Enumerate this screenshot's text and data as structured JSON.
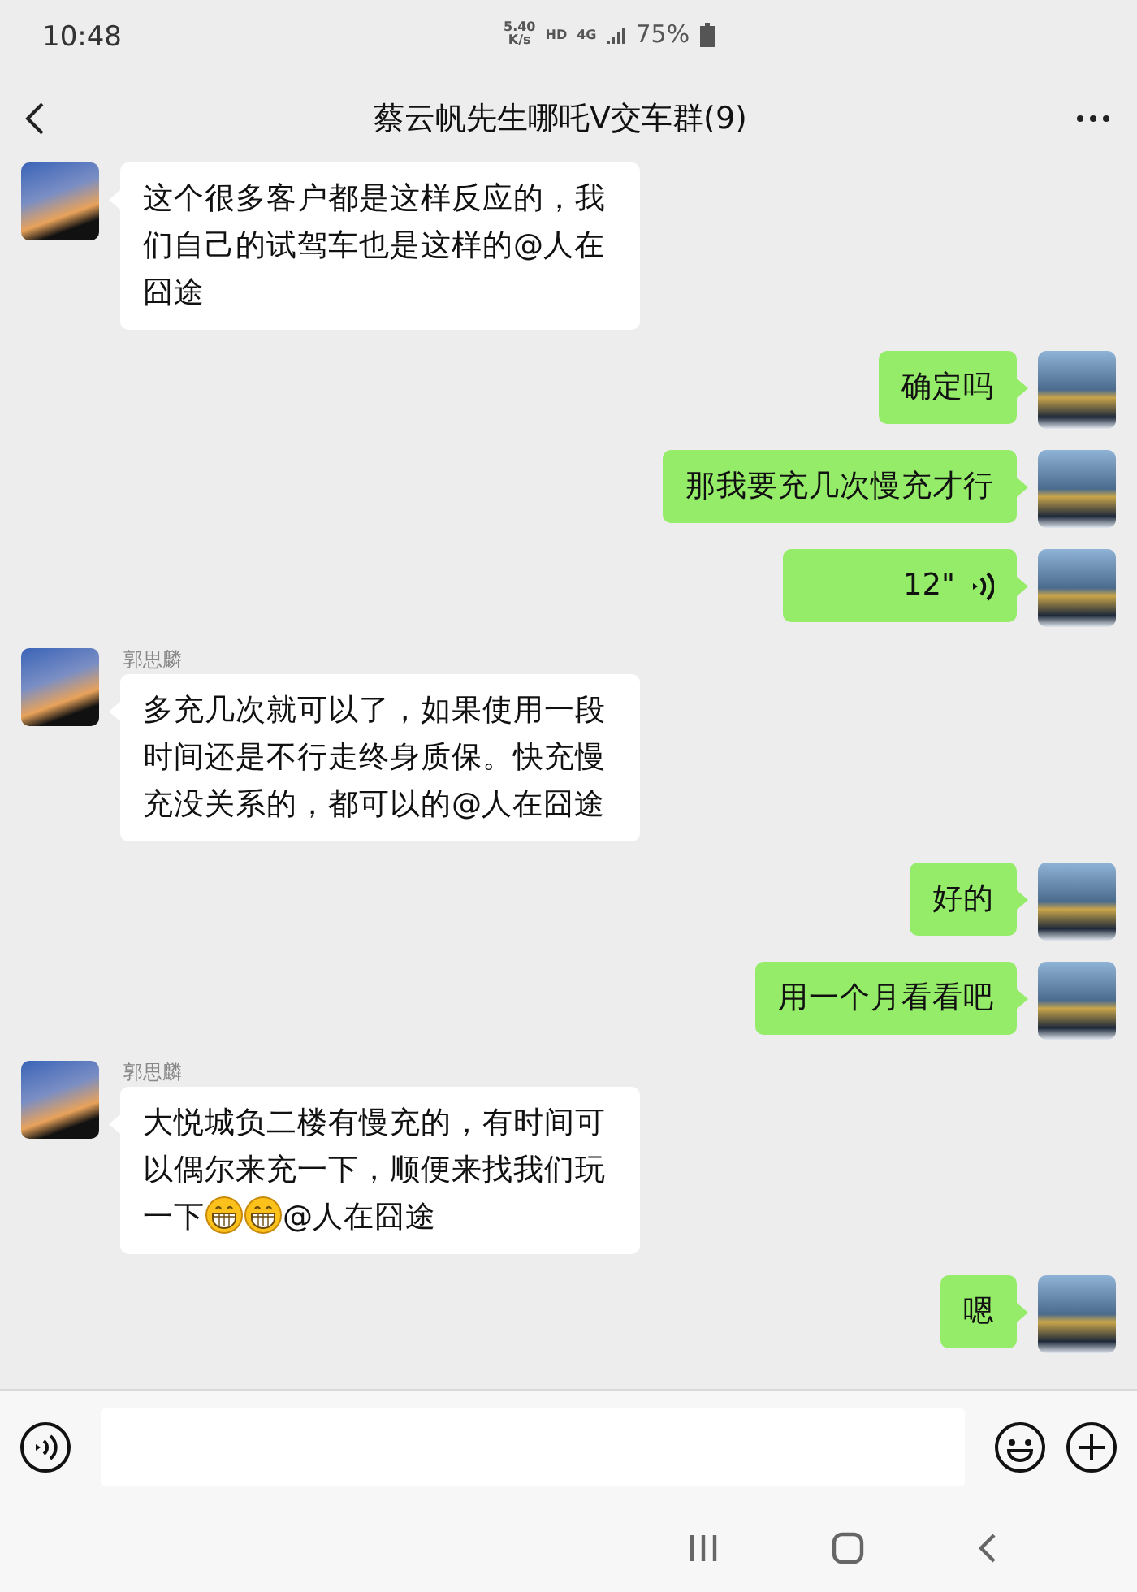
{
  "status_bar": {
    "time": "10:48",
    "speed": "5.40",
    "speed_unit": "K/s",
    "hd": "HD",
    "network": "4G",
    "battery": "75%"
  },
  "header": {
    "title": "蔡云帆先生哪吒V交车群(9)"
  },
  "messages": [
    {
      "kind": "text",
      "outgoing": false,
      "segments": [
        {
          "kind": "text",
          "text": "这个很多客户都是这样反应的，我们自己的试驾车也是这样的@人在囧途"
        }
      ]
    },
    {
      "kind": "text",
      "outgoing": true,
      "segments": [
        {
          "kind": "text",
          "text": "确定吗"
        }
      ]
    },
    {
      "kind": "text",
      "outgoing": true,
      "segments": [
        {
          "kind": "text",
          "text": "那我要充几次慢充才行"
        }
      ]
    },
    {
      "kind": "voice",
      "outgoing": true,
      "duration": "12\""
    },
    {
      "kind": "text",
      "outgoing": false,
      "sender": "郭思麟",
      "segments": [
        {
          "kind": "text",
          "text": "多充几次就可以了，如果使用一段时间还是不行走终身质保。快充慢充没关系的，都可以的@人在囧途"
        }
      ]
    },
    {
      "kind": "text",
      "outgoing": true,
      "segments": [
        {
          "kind": "text",
          "text": "好的"
        }
      ]
    },
    {
      "kind": "text",
      "outgoing": true,
      "segments": [
        {
          "kind": "text",
          "text": "用一个月看看吧"
        }
      ]
    },
    {
      "kind": "text",
      "outgoing": false,
      "sender": "郭思麟",
      "segments": [
        {
          "kind": "text",
          "text": "大悦城负二楼有慢充的，有时间可以偶尔来充一下，顺便来找我们玩一下"
        },
        {
          "kind": "emoji"
        },
        {
          "kind": "emoji"
        },
        {
          "kind": "text",
          "text": "@人在囧途"
        }
      ]
    },
    {
      "kind": "text",
      "outgoing": true,
      "segments": [
        {
          "kind": "text",
          "text": "嗯"
        }
      ]
    }
  ]
}
